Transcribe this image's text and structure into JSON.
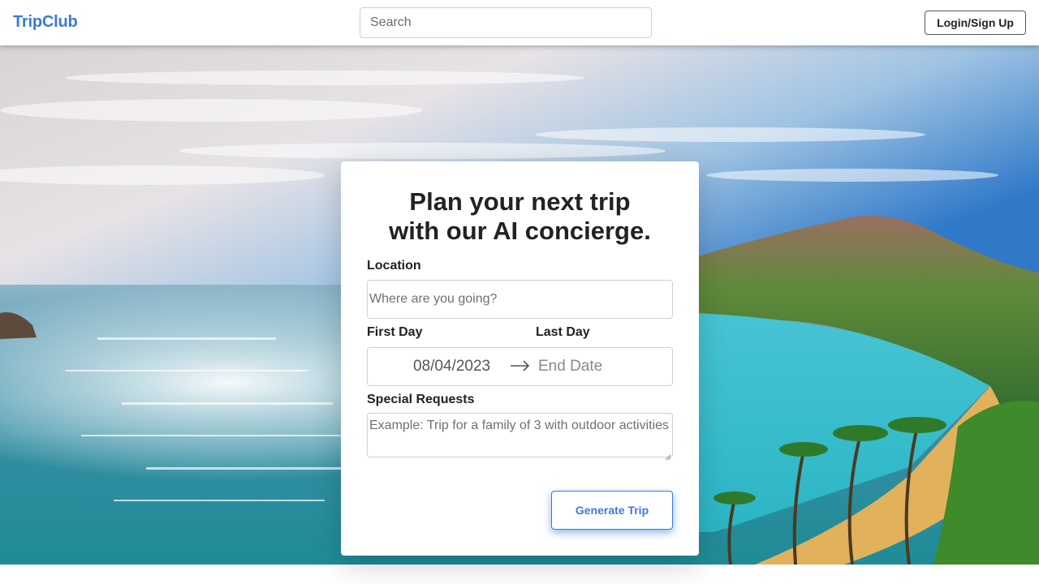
{
  "header": {
    "logo": "TripClub",
    "search_placeholder": "Search",
    "login_label": "Login/Sign Up"
  },
  "hero": {
    "image": "tropical-bay-beach-scenery"
  },
  "form": {
    "title_line1": "Plan your next trip",
    "title_line2": "with our AI concierge.",
    "location_label": "Location",
    "location_placeholder": "Where are you going?",
    "first_day_label": "First Day",
    "last_day_label": "Last Day",
    "start_date": "08/04/2023",
    "end_date_placeholder": "End Date",
    "special_requests_label": "Special Requests",
    "special_requests_placeholder": "Example: Trip for a family of 3 with outdoor activities",
    "generate_label": "Generate Trip"
  },
  "colors": {
    "brand": "#3a7bd5",
    "text": "#222222",
    "border": "#cfcfcf"
  },
  "icons": [
    "arrow-right-icon",
    "resize-grip-icon"
  ]
}
